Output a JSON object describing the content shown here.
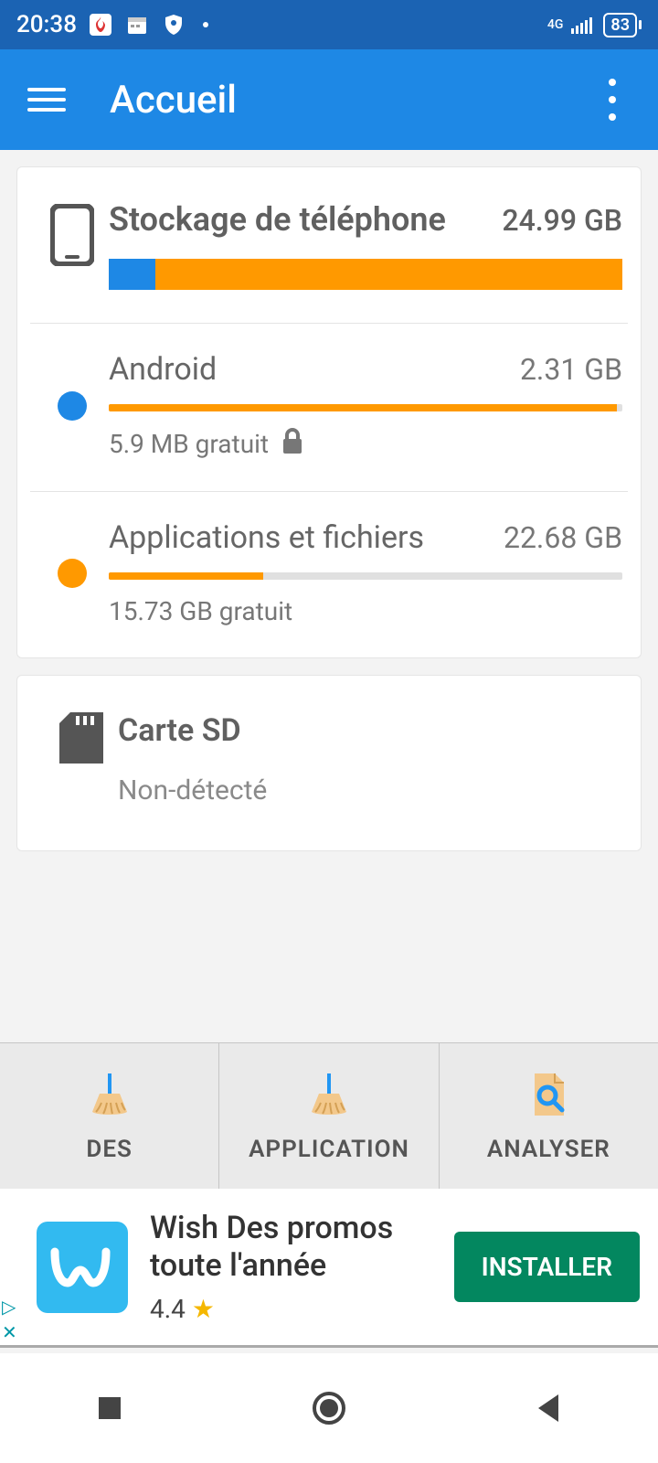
{
  "statusbar": {
    "time": "20:38",
    "net": "4G",
    "battery": "83"
  },
  "toolbar": {
    "title": "Accueil"
  },
  "storage": {
    "title": "Stockage de téléphone",
    "total": "24.99 GB",
    "bar": [
      {
        "color": "#1e88e5",
        "pct": 9
      },
      {
        "color": "#f90",
        "pct": 91
      }
    ],
    "android": {
      "label": "Android",
      "size": "2.31 GB",
      "bar_pct": 99,
      "free": "5.9 MB gratuit",
      "locked": true
    },
    "apps": {
      "label": "Applications et fichiers",
      "size": "22.68 GB",
      "bar_pct": 30,
      "free": "15.73 GB gratuit"
    }
  },
  "sdcard": {
    "title": "Carte SD",
    "status": "Non-détecté"
  },
  "tabs": {
    "des": "DES",
    "application": "APPLICATION",
    "analyser": "ANALYSER"
  },
  "ad": {
    "title_line1": "Wish Des promos",
    "title_line2": "toute l'année",
    "rating": "4.4",
    "button": "INSTALLER"
  }
}
